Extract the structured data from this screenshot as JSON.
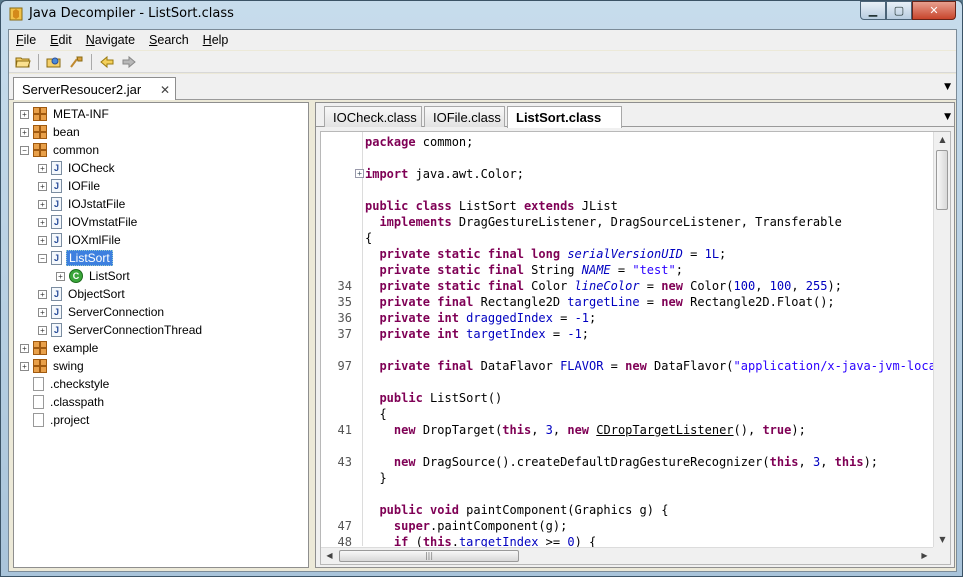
{
  "window": {
    "title": "Java Decompiler - ListSort.class"
  },
  "menu": [
    {
      "first": "F",
      "rest": "ile"
    },
    {
      "first": "E",
      "rest": "dit"
    },
    {
      "first": "N",
      "rest": "avigate"
    },
    {
      "first": "S",
      "rest": "earch"
    },
    {
      "first": "H",
      "rest": "elp"
    }
  ],
  "toolbar": {
    "open_icon": "open-folder-icon",
    "open_type_icon": "open-type-icon",
    "search_icon": "search-icon",
    "back_icon": "back-arrow-icon",
    "forward_icon": "forward-arrow-icon"
  },
  "outer_tab": {
    "label": "ServerResoucer2.jar",
    "close": "✕"
  },
  "tree": [
    {
      "label": "META-INF",
      "indent": 0,
      "expander": "+",
      "icon": "package"
    },
    {
      "label": "bean",
      "indent": 0,
      "expander": "+",
      "icon": "package"
    },
    {
      "label": "common",
      "indent": 0,
      "expander": "−",
      "icon": "package"
    },
    {
      "label": "IOCheck",
      "indent": 1,
      "expander": "+",
      "icon": "java"
    },
    {
      "label": "IOFile",
      "indent": 1,
      "expander": "+",
      "icon": "java"
    },
    {
      "label": "IOJstatFile",
      "indent": 1,
      "expander": "+",
      "icon": "java"
    },
    {
      "label": "IOVmstatFile",
      "indent": 1,
      "expander": "+",
      "icon": "java"
    },
    {
      "label": "IOXmlFile",
      "indent": 1,
      "expander": "+",
      "icon": "java"
    },
    {
      "label": "ListSort",
      "indent": 1,
      "expander": "−",
      "icon": "java",
      "selected": true
    },
    {
      "label": "ListSort",
      "indent": 2,
      "expander": "+",
      "icon": "class"
    },
    {
      "label": "ObjectSort",
      "indent": 1,
      "expander": "+",
      "icon": "java"
    },
    {
      "label": "ServerConnection",
      "indent": 1,
      "expander": "+",
      "icon": "java"
    },
    {
      "label": "ServerConnectionThread",
      "indent": 1,
      "expander": "+",
      "icon": "java"
    },
    {
      "label": "example",
      "indent": 0,
      "expander": "+",
      "icon": "package"
    },
    {
      "label": "swing",
      "indent": 0,
      "expander": "+",
      "icon": "package"
    },
    {
      "label": ".checkstyle",
      "indent": 0,
      "expander": "",
      "icon": "file"
    },
    {
      "label": ".classpath",
      "indent": 0,
      "expander": "",
      "icon": "file"
    },
    {
      "label": ".project",
      "indent": 0,
      "expander": "",
      "icon": "file"
    }
  ],
  "inner_tabs": [
    {
      "label": "IOCheck.class",
      "active": false
    },
    {
      "label": "IOFile.class",
      "active": false
    },
    {
      "label": "ListSort.class",
      "active": true
    }
  ],
  "code_lines": [
    {
      "ln": "",
      "fold": false,
      "html": "<span class=\"kw\">package</span> common;"
    },
    {
      "ln": "",
      "fold": false,
      "html": ""
    },
    {
      "ln": "",
      "fold": true,
      "html": "<span class=\"kw\">import</span> java.awt.Color;"
    },
    {
      "ln": "",
      "fold": false,
      "html": ""
    },
    {
      "ln": "",
      "fold": false,
      "html": "<span class=\"kw\">public class</span> ListSort <span class=\"kw\">extends</span> JList"
    },
    {
      "ln": "",
      "fold": false,
      "html": "  <span class=\"kw\">implements</span> DragGestureListener, DragSourceListener, Transferable"
    },
    {
      "ln": "",
      "fold": false,
      "html": "{"
    },
    {
      "ln": "",
      "fold": false,
      "html": "  <span class=\"kw\">private static final long</span> <span class=\"fld\">serialVersionUID</span> = <span class=\"num\">1L</span>;"
    },
    {
      "ln": "",
      "fold": false,
      "html": "  <span class=\"kw\">private static final</span> String <span class=\"fld\">NAME</span> = <span class=\"str\">\"test\"</span>;"
    },
    {
      "ln": "34",
      "fold": false,
      "html": "  <span class=\"kw\">private static final</span> Color <span class=\"fld\">lineColor</span> = <span class=\"kw\">new</span> Color(<span class=\"num\">100</span>, <span class=\"num\">100</span>, <span class=\"num\">255</span>);"
    },
    {
      "ln": "35",
      "fold": false,
      "html": "  <span class=\"kw\">private final</span> Rectangle2D <span class=\"fln\">targetLine</span> = <span class=\"kw\">new</span> Rectangle2D.Float();"
    },
    {
      "ln": "36",
      "fold": false,
      "html": "  <span class=\"kw\">private int</span> <span class=\"fln\">draggedIndex</span> = <span class=\"num\">-1</span>;"
    },
    {
      "ln": "37",
      "fold": false,
      "html": "  <span class=\"kw\">private int</span> <span class=\"fln\">targetIndex</span> = <span class=\"num\">-1</span>;"
    },
    {
      "ln": "",
      "fold": false,
      "html": ""
    },
    {
      "ln": "97",
      "fold": false,
      "html": "  <span class=\"kw\">private final</span> DataFlavor <span class=\"fln\">FLAVOR</span> = <span class=\"kw\">new</span> DataFlavor(<span class=\"str\">\"application/x-java-jvm-local-</span>"
    },
    {
      "ln": "",
      "fold": false,
      "html": ""
    },
    {
      "ln": "",
      "fold": false,
      "html": "  <span class=\"kw\">public</span> ListSort()"
    },
    {
      "ln": "",
      "fold": false,
      "html": "  {"
    },
    {
      "ln": "41",
      "fold": false,
      "html": "    <span class=\"kw\">new</span> DropTarget(<span class=\"kw\">this</span>, <span class=\"num\">3</span>, <span class=\"kw\">new</span> <span class=\"link\">CDropTargetListener</span>(), <span class=\"kw\">true</span>);"
    },
    {
      "ln": "",
      "fold": false,
      "html": ""
    },
    {
      "ln": "43",
      "fold": false,
      "html": "    <span class=\"kw\">new</span> DragSource().createDefaultDragGestureRecognizer(<span class=\"kw\">this</span>, <span class=\"num\">3</span>, <span class=\"kw\">this</span>);"
    },
    {
      "ln": "",
      "fold": false,
      "html": "  }"
    },
    {
      "ln": "",
      "fold": false,
      "html": ""
    },
    {
      "ln": "",
      "fold": false,
      "html": "  <span class=\"kw\">public void</span> paintComponent(Graphics g) {"
    },
    {
      "ln": "47",
      "fold": false,
      "html": "    <span class=\"kw\">super</span>.paintComponent(g);"
    },
    {
      "ln": "48",
      "fold": false,
      "html": "    <span class=\"kw\">if</span> (<span class=\"kw\">this</span>.<span class=\"fln\">targetIndex</span> &gt;= <span class=\"num\">0</span>) {"
    }
  ],
  "scroll": {
    "h_grip": "|||"
  }
}
